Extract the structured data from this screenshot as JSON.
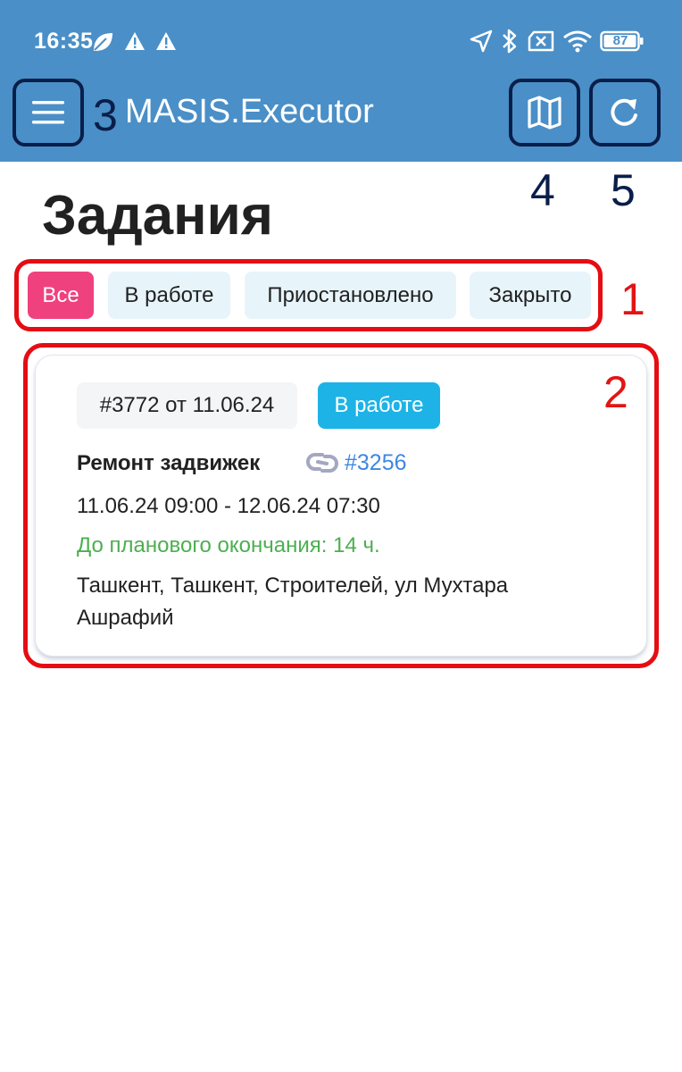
{
  "status_bar": {
    "time": "16:35",
    "battery": "87",
    "icons": [
      "leaf-icon",
      "warning-icon",
      "warning-icon",
      "location-arrow-icon",
      "bluetooth-icon",
      "sim-off-icon",
      "wifi-icon",
      "battery-icon"
    ]
  },
  "header": {
    "app_title": "MASIS.Executor",
    "menu_icon": "hamburger-menu-icon",
    "map_icon": "map-icon",
    "refresh_icon": "refresh-icon"
  },
  "page": {
    "title": "Задания"
  },
  "filters": [
    {
      "label": "Все",
      "active": true
    },
    {
      "label": "В работе",
      "active": false
    },
    {
      "label": "Приостановлено",
      "active": false
    },
    {
      "label": "Закрыто",
      "active": false
    }
  ],
  "tasks": [
    {
      "order": "#3772 от 11.06.24",
      "status": "В работе",
      "name": "Ремонт задвижек",
      "link_icon": "link-chain-icon",
      "link": "#3256",
      "dates": "11.06.24 09:00 - 12.06.24 07:30",
      "deadline": "До планового окончания: 14 ч.",
      "address": "Ташкент, Ташкент, Строителей, ул Мухтара Ашрафий"
    }
  ],
  "annotations": {
    "filters": "1",
    "card": "2",
    "menu": "3",
    "map": "4",
    "refresh": "5"
  },
  "colors": {
    "header_bg": "#4a8fc7",
    "active_chip": "#f0417f",
    "chip_bg": "#e7f4fa",
    "status_chip": "#1eb3e6",
    "deadline_text": "#4caf50",
    "link_text": "#3f87e3",
    "annotation_red": "#e50d13",
    "annotation_dark": "#0a1e4a"
  }
}
